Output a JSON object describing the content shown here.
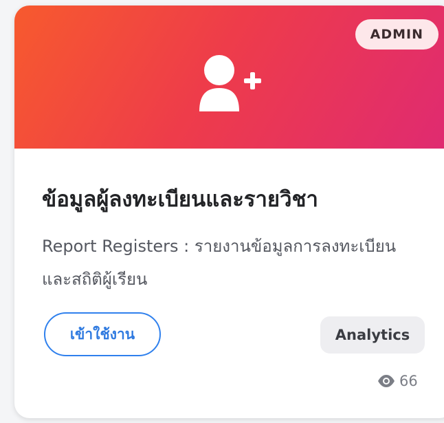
{
  "card": {
    "badge": "ADMIN",
    "icon": "user-plus-icon",
    "title": "ข้อมูลผู้ลงทะเบียนและรายวิชา",
    "description": "Report Registers : รายงานข้อมูลการลงทะเบียนและสถิติผู้เรียน",
    "button_label": "เข้าใช้งาน",
    "tag": "Analytics",
    "views_icon": "eye-icon",
    "views": "66"
  },
  "colors": {
    "banner_gradient_start": "#f75a2e",
    "banner_gradient_end": "#df2a72",
    "badge_bg": "#fde7ea",
    "button_accent": "#2f80ed",
    "tag_bg": "#eeeef1"
  }
}
